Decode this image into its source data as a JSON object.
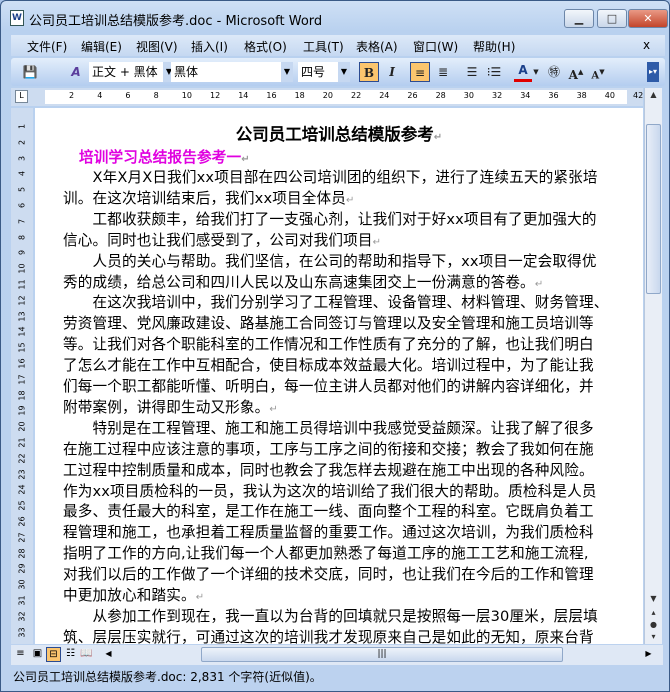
{
  "window": {
    "title": "公司员工培训总结模版参考.doc - Microsoft Word"
  },
  "menu": [
    "文件(F)",
    "编辑(E)",
    "视图(V)",
    "插入(I)",
    "格式(O)",
    "工具(T)",
    "表格(A)",
    "窗口(W)",
    "帮助(H)"
  ],
  "menu_close": "x",
  "toolbar": {
    "style": "正文 + 黑体",
    "font": "黑体",
    "size": "四号",
    "bold": "B",
    "italic": "I",
    "font_color": "#e00000"
  },
  "ruler": {
    "h": [
      "2",
      "4",
      "6",
      "8",
      "10",
      "12",
      "14",
      "16",
      "18",
      "20",
      "22",
      "24",
      "26",
      "28",
      "30",
      "32",
      "34",
      "36",
      "38",
      "40",
      "42"
    ],
    "v": [
      "1",
      "2",
      "3",
      "4",
      "5",
      "6",
      "7",
      "8",
      "9",
      "10",
      "11",
      "12",
      "13",
      "14",
      "15",
      "16",
      "17",
      "18",
      "19",
      "20",
      "21",
      "22",
      "23",
      "24",
      "25",
      "26",
      "27",
      "28",
      "29",
      "30",
      "31",
      "32",
      "33"
    ]
  },
  "document": {
    "title": "公司员工培训总结模版参考",
    "subhead": "培训学习总结报告参考一",
    "lines": [
      {
        "t": "　　X年X月X日我们xx项目部在四公司培训团的组织下，进行了连续五天的紧张培",
        "pm": false
      },
      {
        "t": "训。在这次培训结束后，我们xx项目全体员",
        "pm": true
      },
      {
        "t": "　　工都收获颇丰，给我们打了一支强心剂，让我们对于好xx项目有了更加强大的",
        "pm": false
      },
      {
        "t": "信心。同时也让我们感受到了，公司对我们项目",
        "pm": true
      },
      {
        "t": "　　人员的关心与帮助。我们坚信，在公司的帮助和指导下，xx项目一定会取得优",
        "pm": false
      },
      {
        "t": "秀的成绩，给总公司和四川人民以及山东高速集团交上一份满意的答卷。",
        "pm": true
      },
      {
        "t": "　　在这次我培训中，我们分别学习了工程管理、设备管理、材料管理、财务管理、",
        "pm": false
      },
      {
        "t": "劳资管理、党风廉政建设、路基施工合同签订与管理以及安全管理和施工员培训等",
        "pm": false
      },
      {
        "t": "等。让我们对各个职能科室的工作情况和工作性质有了充分的了解，也让我们明白",
        "pm": false
      },
      {
        "t": "了怎么才能在工作中互相配合，使目标成本效益最大化。培训过程中，为了能让我",
        "pm": false
      },
      {
        "t": "们每一个职工都能听懂、听明白，每一位主讲人员都对他们的讲解内容详细化，并",
        "pm": false
      },
      {
        "t": "附带案例，讲得即生动又形象。",
        "pm": true
      },
      {
        "t": "　　特别是在工程管理、施工和施工员得培训中我感觉受益颇深。让我了解了很多",
        "pm": false
      },
      {
        "t": "在施工过程中应该注意的事项，工序与工序之间的衔接和交接；教会了我如何在施",
        "pm": false
      },
      {
        "t": "工过程中控制质量和成本，同时也教会了我怎样去规避在施工中出现的各种风险。",
        "pm": false
      },
      {
        "t": "作为xx项目质检科的一员，我认为这次的培训给了我们很大的帮助。质检科是人员",
        "pm": false
      },
      {
        "t": "最多、责任最大的科室，是工作在施工一线、面向整个工程的科室。它既肩负着工",
        "pm": false
      },
      {
        "t": "程管理和施工，也承担着工程质量监督的重要工作。通过这次培训，为我们质检科",
        "pm": false
      },
      {
        "t": "指明了工作的方向,让我们每一个人都更加熟悉了每道工序的施工工艺和施工流程,",
        "pm": false
      },
      {
        "t": "对我们以后的工作做了一个详细的技术交底，同时，也让我们在今后的工作和管理",
        "pm": false
      },
      {
        "t": "中更加放心和踏实。",
        "pm": true
      },
      {
        "t": "　　从参加工作到现在，我一直以为台背的回填就只是按照每一层30厘米，层层填",
        "pm": false
      },
      {
        "t": "筑、层层压实就行，可通过这次的培训我才发现原来自己是如此的无知，原来台背",
        "pm": false
      }
    ]
  },
  "status": {
    "text": "公司员工培训总结模版参考.doc: 2,831 个字符(近似值)。"
  }
}
